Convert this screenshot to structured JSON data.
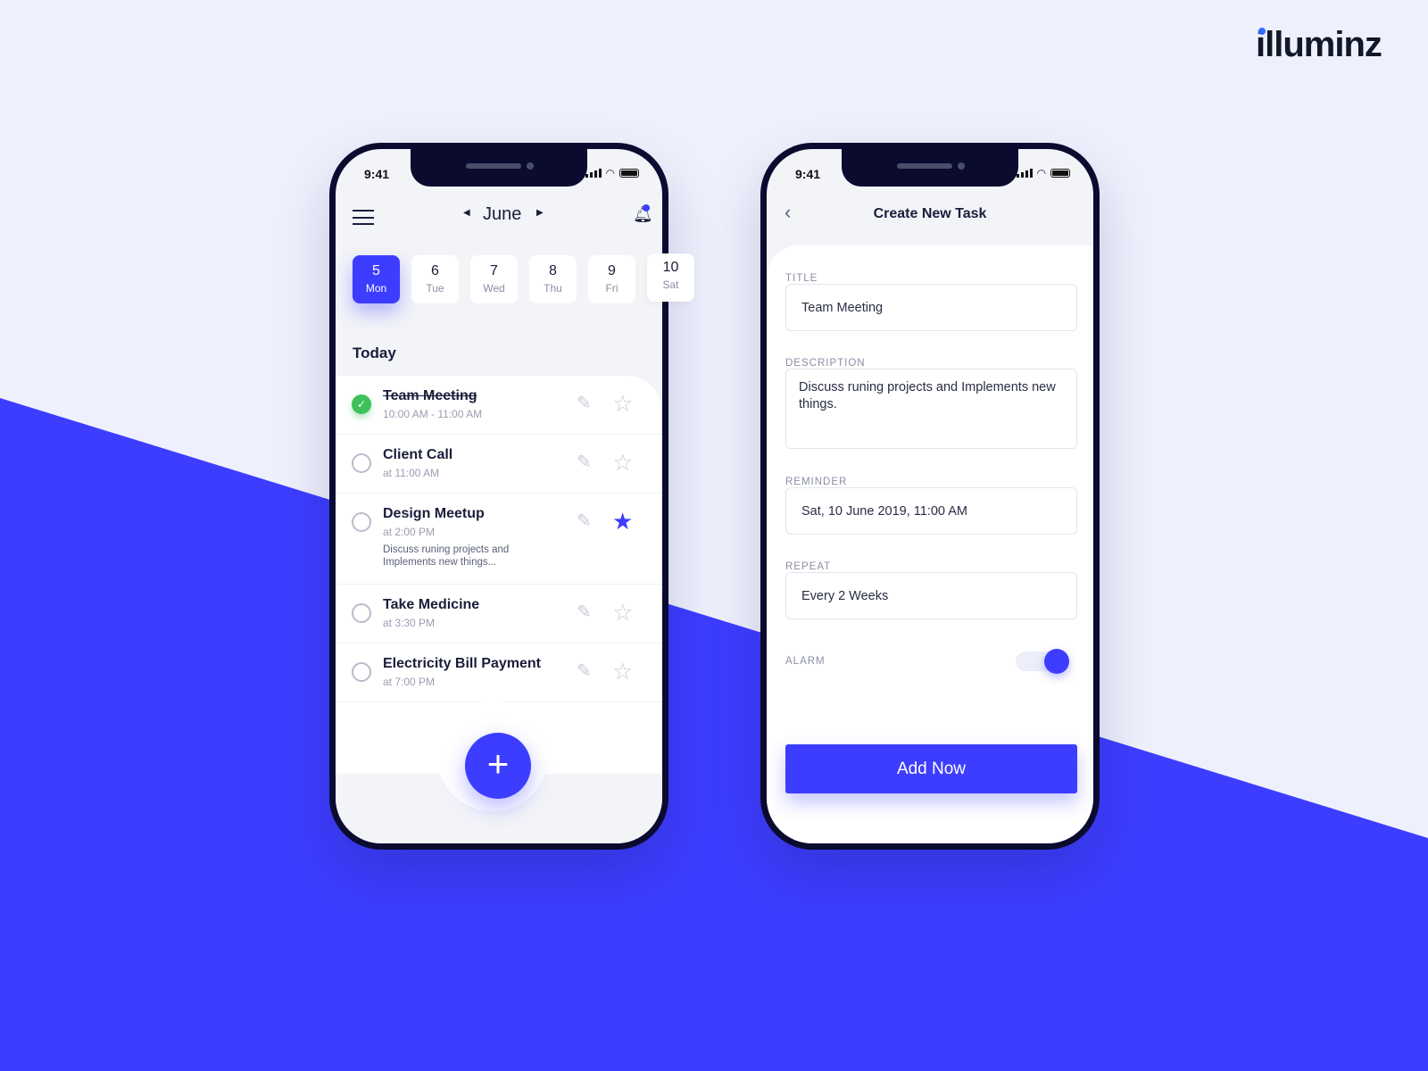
{
  "brand": {
    "logo": "illuminz"
  },
  "colors": {
    "accent": "#3d3dff",
    "done": "#3ec15a",
    "background": "#eef0fd"
  },
  "status": {
    "time": "9:41"
  },
  "calendar": {
    "month": "June",
    "days": [
      {
        "num": "5",
        "day": "Mon",
        "selected": true
      },
      {
        "num": "6",
        "day": "Tue"
      },
      {
        "num": "7",
        "day": "Wed"
      },
      {
        "num": "8",
        "day": "Thu"
      },
      {
        "num": "9",
        "day": "Fri"
      },
      {
        "num": "10",
        "day": "Sat"
      }
    ],
    "section": "Today"
  },
  "tasks": [
    {
      "title": "Team Meeting",
      "time": "10:00 AM - 11:00 AM",
      "done": true,
      "starred": false
    },
    {
      "title": "Client Call",
      "time": "at 11:00 AM",
      "done": false,
      "starred": false
    },
    {
      "title": "Design Meetup",
      "time": "at 2:00 PM",
      "desc": "Discuss runing projects and Implements new things...",
      "done": false,
      "starred": true
    },
    {
      "title": "Take Medicine",
      "time": "at 3:30 PM",
      "done": false,
      "starred": false
    },
    {
      "title": "Electricity Bill Payment",
      "time": "at 7:00 PM",
      "done": false,
      "starred": false
    }
  ],
  "fab": {
    "label": "+"
  },
  "create": {
    "title": "Create New Task",
    "fields": {
      "title_label": "TITLE",
      "title_value": "Team Meeting",
      "desc_label": "DESCRIPTION",
      "desc_value": "Discuss runing projects and  Implements new things.",
      "reminder_label": "REMINDER",
      "reminder_value": "Sat, 10 June 2019, 11:00 AM",
      "repeat_label": "REPEAT",
      "repeat_value": "Every 2 Weeks",
      "alarm_label": "ALARM",
      "alarm_on": true
    },
    "submit": "Add Now"
  }
}
